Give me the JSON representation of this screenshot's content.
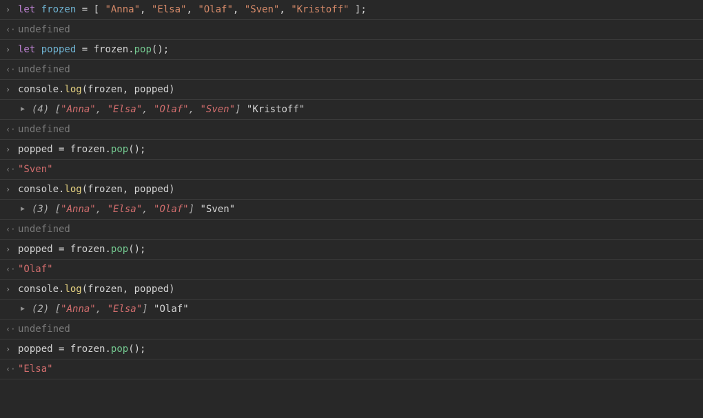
{
  "glyphs": {
    "input": "›",
    "output": "‹·",
    "expand": "▶"
  },
  "rows": [
    {
      "type": "input",
      "tokens": [
        {
          "t": "let ",
          "c": "kw-let"
        },
        {
          "t": "frozen",
          "c": "var-name"
        },
        {
          "t": " = ",
          "c": "op"
        },
        {
          "t": "[ ",
          "c": "bracket"
        },
        {
          "t": "\"Anna\"",
          "c": "str"
        },
        {
          "t": ", ",
          "c": "op"
        },
        {
          "t": "\"Elsa\"",
          "c": "str"
        },
        {
          "t": ", ",
          "c": "op"
        },
        {
          "t": "\"Olaf\"",
          "c": "str"
        },
        {
          "t": ", ",
          "c": "op"
        },
        {
          "t": "\"Sven\"",
          "c": "str"
        },
        {
          "t": ", ",
          "c": "op"
        },
        {
          "t": "\"Kristoff\"",
          "c": "str"
        },
        {
          "t": " ]",
          "c": "bracket"
        },
        {
          "t": ";",
          "c": "semi"
        }
      ]
    },
    {
      "type": "output",
      "tokens": [
        {
          "t": "undefined",
          "c": "undefined"
        }
      ]
    },
    {
      "type": "input",
      "tokens": [
        {
          "t": "let ",
          "c": "kw-let"
        },
        {
          "t": "popped",
          "c": "var-name"
        },
        {
          "t": " = ",
          "c": "op"
        },
        {
          "t": "frozen",
          "c": "plain"
        },
        {
          "t": ".",
          "c": "op"
        },
        {
          "t": "pop",
          "c": "method-pop"
        },
        {
          "t": "();",
          "c": "bracket"
        }
      ]
    },
    {
      "type": "output",
      "tokens": [
        {
          "t": "undefined",
          "c": "undefined"
        }
      ]
    },
    {
      "type": "input",
      "tokens": [
        {
          "t": "console",
          "c": "id-console"
        },
        {
          "t": ".",
          "c": "op"
        },
        {
          "t": "log",
          "c": "method-log"
        },
        {
          "t": "(frozen, popped)",
          "c": "plain"
        }
      ]
    },
    {
      "type": "log",
      "tokens": [
        {
          "t": "(4) ",
          "c": "res-num"
        },
        {
          "t": "[",
          "c": "res-num"
        },
        {
          "t": "\"Anna\"",
          "c": "res-str res-italic"
        },
        {
          "t": ", ",
          "c": "res-num"
        },
        {
          "t": "\"Elsa\"",
          "c": "res-str res-italic"
        },
        {
          "t": ", ",
          "c": "res-num"
        },
        {
          "t": "\"Olaf\"",
          "c": "res-str res-italic"
        },
        {
          "t": ", ",
          "c": "res-num"
        },
        {
          "t": "\"Sven\"",
          "c": "res-str res-italic"
        },
        {
          "t": "]",
          "c": "res-num"
        },
        {
          "t": " ",
          "c": "plain"
        },
        {
          "t": "\"Kristoff\"",
          "c": "plain"
        }
      ]
    },
    {
      "type": "output",
      "tokens": [
        {
          "t": "undefined",
          "c": "undefined"
        }
      ]
    },
    {
      "type": "input",
      "tokens": [
        {
          "t": "popped",
          "c": "plain"
        },
        {
          "t": " = ",
          "c": "op"
        },
        {
          "t": "frozen",
          "c": "plain"
        },
        {
          "t": ".",
          "c": "op"
        },
        {
          "t": "pop",
          "c": "method-pop"
        },
        {
          "t": "();",
          "c": "bracket"
        }
      ]
    },
    {
      "type": "output",
      "tokens": [
        {
          "t": "\"Sven\"",
          "c": "res-str"
        }
      ]
    },
    {
      "type": "input",
      "tokens": [
        {
          "t": "console",
          "c": "id-console"
        },
        {
          "t": ".",
          "c": "op"
        },
        {
          "t": "log",
          "c": "method-log"
        },
        {
          "t": "(frozen, popped)",
          "c": "plain"
        }
      ]
    },
    {
      "type": "log",
      "tokens": [
        {
          "t": "(3) ",
          "c": "res-num"
        },
        {
          "t": "[",
          "c": "res-num"
        },
        {
          "t": "\"Anna\"",
          "c": "res-str res-italic"
        },
        {
          "t": ", ",
          "c": "res-num"
        },
        {
          "t": "\"Elsa\"",
          "c": "res-str res-italic"
        },
        {
          "t": ", ",
          "c": "res-num"
        },
        {
          "t": "\"Olaf\"",
          "c": "res-str res-italic"
        },
        {
          "t": "]",
          "c": "res-num"
        },
        {
          "t": " ",
          "c": "plain"
        },
        {
          "t": "\"Sven\"",
          "c": "plain"
        }
      ]
    },
    {
      "type": "output",
      "tokens": [
        {
          "t": "undefined",
          "c": "undefined"
        }
      ]
    },
    {
      "type": "input",
      "tokens": [
        {
          "t": "popped",
          "c": "plain"
        },
        {
          "t": " = ",
          "c": "op"
        },
        {
          "t": "frozen",
          "c": "plain"
        },
        {
          "t": ".",
          "c": "op"
        },
        {
          "t": "pop",
          "c": "method-pop"
        },
        {
          "t": "();",
          "c": "bracket"
        }
      ]
    },
    {
      "type": "output",
      "tokens": [
        {
          "t": "\"Olaf\"",
          "c": "res-str"
        }
      ]
    },
    {
      "type": "input",
      "tokens": [
        {
          "t": "console",
          "c": "id-console"
        },
        {
          "t": ".",
          "c": "op"
        },
        {
          "t": "log",
          "c": "method-log"
        },
        {
          "t": "(frozen, popped)",
          "c": "plain"
        }
      ]
    },
    {
      "type": "log",
      "tokens": [
        {
          "t": "(2) ",
          "c": "res-num"
        },
        {
          "t": "[",
          "c": "res-num"
        },
        {
          "t": "\"Anna\"",
          "c": "res-str res-italic"
        },
        {
          "t": ", ",
          "c": "res-num"
        },
        {
          "t": "\"Elsa\"",
          "c": "res-str res-italic"
        },
        {
          "t": "]",
          "c": "res-num"
        },
        {
          "t": " ",
          "c": "plain"
        },
        {
          "t": "\"Olaf\"",
          "c": "plain"
        }
      ]
    },
    {
      "type": "output",
      "tokens": [
        {
          "t": "undefined",
          "c": "undefined"
        }
      ]
    },
    {
      "type": "input",
      "tokens": [
        {
          "t": "popped",
          "c": "plain"
        },
        {
          "t": " = ",
          "c": "op"
        },
        {
          "t": "frozen",
          "c": "plain"
        },
        {
          "t": ".",
          "c": "op"
        },
        {
          "t": "pop",
          "c": "method-pop"
        },
        {
          "t": "();",
          "c": "bracket"
        }
      ]
    },
    {
      "type": "output",
      "tokens": [
        {
          "t": "\"Elsa\"",
          "c": "res-str"
        }
      ]
    }
  ]
}
